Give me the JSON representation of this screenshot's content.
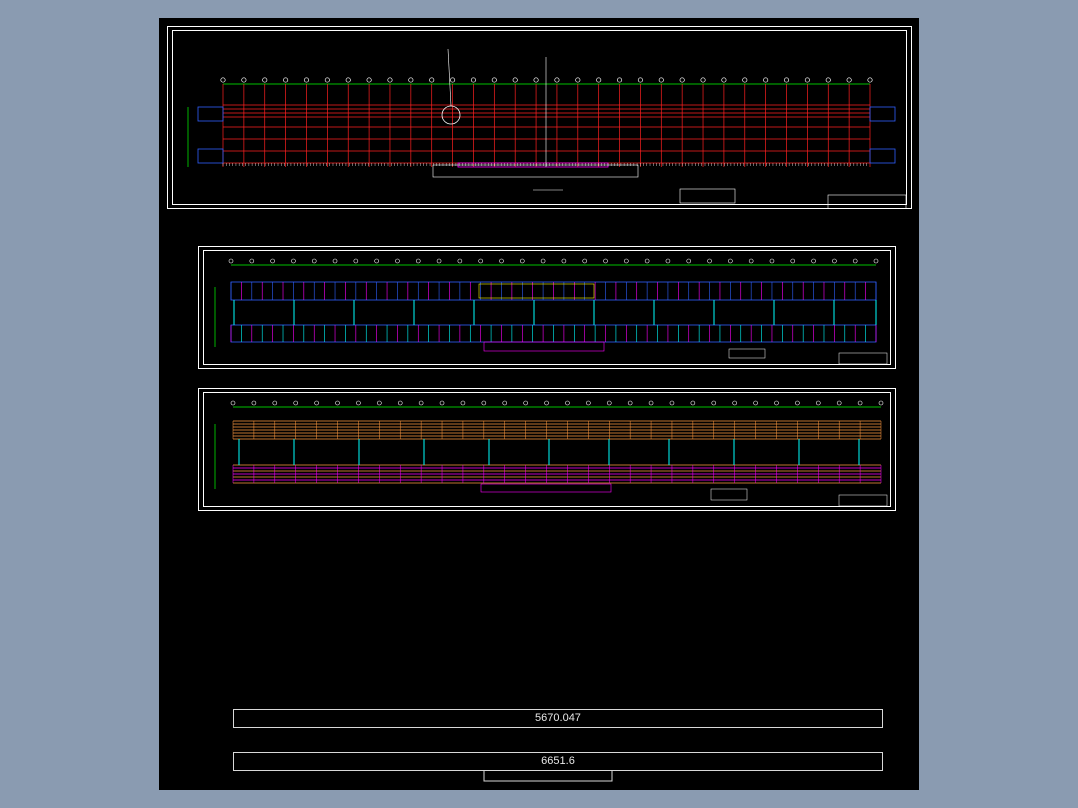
{
  "viewport": {
    "background_color": "#8a9bb1",
    "canvas_color": "#000000"
  },
  "sheets": [
    {
      "name": "sheet-1",
      "content": "plan-drawing"
    },
    {
      "name": "sheet-2",
      "content": "elevation-drawing"
    },
    {
      "name": "sheet-3",
      "content": "section-drawing"
    }
  ],
  "dimensions": {
    "upper_value": "5670.047",
    "lower_value": "6651.6"
  },
  "colors": {
    "grid_red": "#ff2020",
    "axis_green": "#00ff00",
    "blue": "#3060ff",
    "magenta": "#ff00ff",
    "cyan": "#00ffff",
    "yellow": "#ffff00",
    "orange": "#ff9a40",
    "white": "#ffffff"
  }
}
